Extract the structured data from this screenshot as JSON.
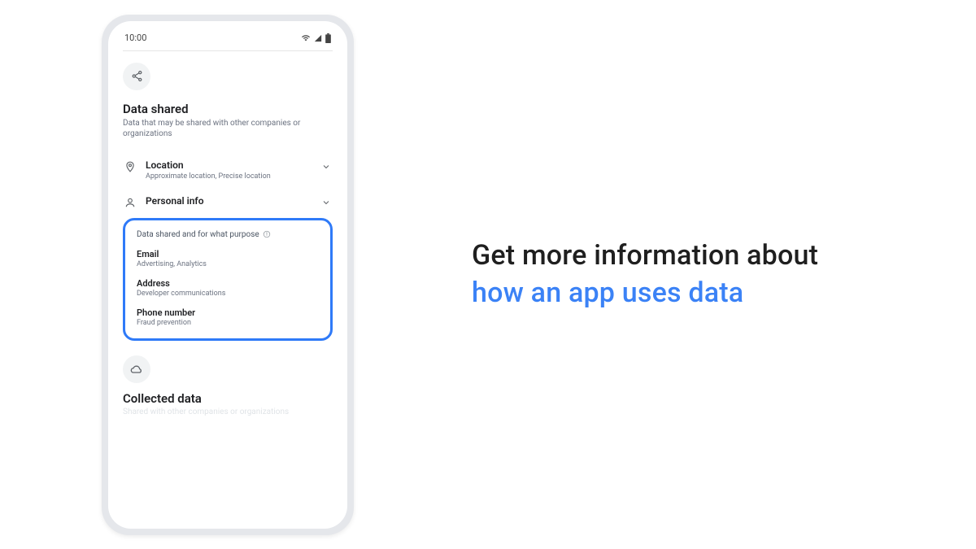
{
  "statusbar": {
    "time": "10:00"
  },
  "headline": {
    "line1": "Get more information about",
    "line2": "how an app uses data"
  },
  "data_shared": {
    "title": "Data shared",
    "subtitle": "Data that may be shared with other companies or organizations",
    "categories": [
      {
        "icon": "location-pin-icon",
        "title": "Location",
        "sub": "Approximate location, Precise location"
      },
      {
        "icon": "person-icon",
        "title": "Personal info",
        "sub": ""
      }
    ]
  },
  "highlight": {
    "header": "Data shared and for what purpose",
    "items": [
      {
        "title": "Email",
        "sub": "Advertising, Analytics"
      },
      {
        "title": "Address",
        "sub": "Developer communications"
      },
      {
        "title": "Phone number",
        "sub": "Fraud prevention"
      }
    ]
  },
  "collected": {
    "title": "Collected data",
    "subtitle": "Shared with other companies or organizations"
  }
}
